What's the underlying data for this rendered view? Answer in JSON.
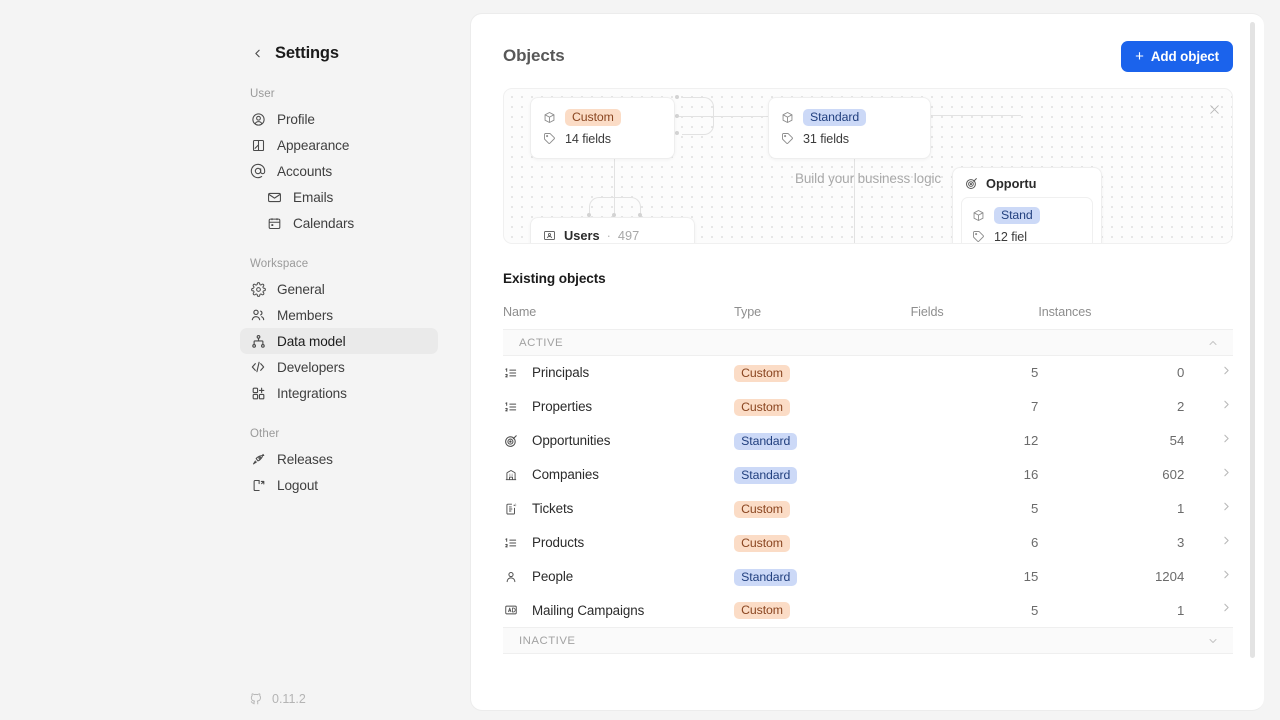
{
  "sidebar": {
    "title": "Settings",
    "back_icon": "chevron-left-icon",
    "groups": [
      {
        "label": "User",
        "items": [
          {
            "label": "Profile",
            "icon": "user-circle-icon",
            "active": false,
            "sub": false
          },
          {
            "label": "Appearance",
            "icon": "appearance-icon",
            "active": false,
            "sub": false
          },
          {
            "label": "Accounts",
            "icon": "at-sign-icon",
            "active": false,
            "sub": false
          },
          {
            "label": "Emails",
            "icon": "mail-icon",
            "active": false,
            "sub": true
          },
          {
            "label": "Calendars",
            "icon": "calendar-icon",
            "active": false,
            "sub": true
          }
        ]
      },
      {
        "label": "Workspace",
        "items": [
          {
            "label": "General",
            "icon": "gear-icon",
            "active": false,
            "sub": false
          },
          {
            "label": "Members",
            "icon": "users-icon",
            "active": false,
            "sub": false
          },
          {
            "label": "Data model",
            "icon": "hierarchy-icon",
            "active": true,
            "sub": false
          },
          {
            "label": "Developers",
            "icon": "code-icon",
            "active": false,
            "sub": false
          },
          {
            "label": "Integrations",
            "icon": "grid-plus-icon",
            "active": false,
            "sub": false
          }
        ]
      },
      {
        "label": "Other",
        "items": [
          {
            "label": "Releases",
            "icon": "rocket-icon",
            "active": false,
            "sub": false
          },
          {
            "label": "Logout",
            "icon": "logout-icon",
            "active": false,
            "sub": false
          }
        ]
      }
    ],
    "version": "0.11.2",
    "version_icon": "github-icon"
  },
  "header": {
    "title": "Objects",
    "add_button": "Add object",
    "add_button_icon": "plus-icon",
    "accent_color": "#1b63ec"
  },
  "canvas": {
    "caption": "Build your business logic",
    "close_icon": "close-icon",
    "nodes": [
      {
        "id": "node-custom",
        "badge": "Custom",
        "badge_type": "custom",
        "fields": "14 fields"
      },
      {
        "id": "node-standard",
        "badge": "Standard",
        "badge_type": "standard",
        "fields": "31 fields"
      },
      {
        "id": "node-users",
        "title": "Users",
        "separator": "·",
        "count": "497"
      },
      {
        "id": "node-opportunities",
        "title": "Opportu",
        "badge": "Stand",
        "badge_type": "standard",
        "fields": "12 fiel"
      }
    ],
    "cube_icon": "cube-icon",
    "tag_icon": "tag-icon",
    "users_icon": "users-card-icon",
    "target_icon": "target-icon"
  },
  "objects_section": {
    "title": "Existing objects",
    "columns": {
      "name": "Name",
      "type": "Type",
      "fields": "Fields",
      "instances": "Instances"
    },
    "groups": [
      {
        "label": "ACTIVE",
        "expanded": true,
        "chevron": "chevron-up-icon",
        "rows": [
          {
            "name": "Principals",
            "icon": "list-ordered-icon",
            "type": "Custom",
            "type_class": "custom",
            "fields": "5",
            "instances": "0"
          },
          {
            "name": "Properties",
            "icon": "list-ordered-icon",
            "type": "Custom",
            "type_class": "custom",
            "fields": "7",
            "instances": "2"
          },
          {
            "name": "Opportunities",
            "icon": "target-icon",
            "type": "Standard",
            "type_class": "standard",
            "fields": "12",
            "instances": "54"
          },
          {
            "name": "Companies",
            "icon": "building-icon",
            "type": "Standard",
            "type_class": "standard",
            "fields": "16",
            "instances": "602"
          },
          {
            "name": "Tickets",
            "icon": "ticket-icon",
            "type": "Custom",
            "type_class": "custom",
            "fields": "5",
            "instances": "1"
          },
          {
            "name": "Products",
            "icon": "list-ordered-icon",
            "type": "Custom",
            "type_class": "custom",
            "fields": "6",
            "instances": "3"
          },
          {
            "name": "People",
            "icon": "person-icon",
            "type": "Standard",
            "type_class": "standard",
            "fields": "15",
            "instances": "1204"
          },
          {
            "name": "Mailing Campaigns",
            "icon": "ad-icon",
            "type": "Custom",
            "type_class": "custom",
            "fields": "5",
            "instances": "1"
          }
        ]
      },
      {
        "label": "INACTIVE",
        "expanded": false,
        "chevron": "chevron-down-icon",
        "rows": []
      }
    ],
    "row_chevron": "chevron-right-icon",
    "custom_color": "#fbdcc6",
    "standard_color": "#ccd9f7"
  }
}
